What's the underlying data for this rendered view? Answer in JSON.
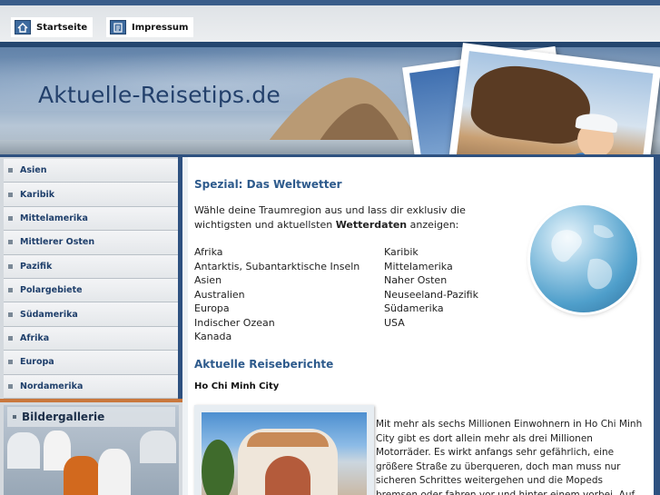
{
  "topnav": {
    "home_label": "Startseite",
    "impressum_label": "Impressum",
    "home_icon": "home-icon",
    "impressum_icon": "document-icon"
  },
  "header": {
    "site_title": "Aktuelle-Reisetips.de"
  },
  "sidebar": {
    "items": [
      {
        "label": "Asien"
      },
      {
        "label": "Karibik"
      },
      {
        "label": "Mittelamerika"
      },
      {
        "label": "Mittlerer Osten"
      },
      {
        "label": "Pazifik"
      },
      {
        "label": "Polargebiete"
      },
      {
        "label": "Südamerika"
      },
      {
        "label": "Afrika"
      },
      {
        "label": "Europa"
      },
      {
        "label": "Nordamerika"
      }
    ],
    "gallery_title": "Bildergallerie"
  },
  "main": {
    "spezial_heading": "Spezial: Das Weltwetter",
    "intro_before": "Wähle deine Traumregion aus und lass dir exklusiv die wichtigsten und aktuellsten ",
    "intro_bold": "Wetterdaten",
    "intro_after": " anzeigen:",
    "regions_left": [
      "Afrika",
      "Antarktis, Subantarktische Inseln",
      "Asien",
      "Australien",
      "Europa",
      "Indischer Ozean",
      "Kanada"
    ],
    "regions_right": [
      "Karibik",
      "Mittelamerika",
      "Naher Osten",
      "Neuseeland-Pazifik",
      "Südamerika",
      "USA"
    ],
    "berichte_heading": "Aktuelle Reiseberichte",
    "report_title": "Ho Chi Minh City",
    "report_text": "Mit mehr als sechs Millionen Einwohnern in Ho Chi Minh City gibt es dort allein mehr als drei Millionen Motorräder. Es wirkt anfangs sehr gefährlich, eine größere Straße zu überqueren, doch man muss nur sicheren Schrittes weitergehen und die Mopeds bremsen oder fahren vor und hinter einem vorbei. Auf keinen Fall zögern oder einen"
  },
  "colors": {
    "accent": "#2d5a8c",
    "nav_text": "#1f3f6b",
    "sidebar_bg": "#d4d9de",
    "divider_orange": "#c9773d"
  }
}
